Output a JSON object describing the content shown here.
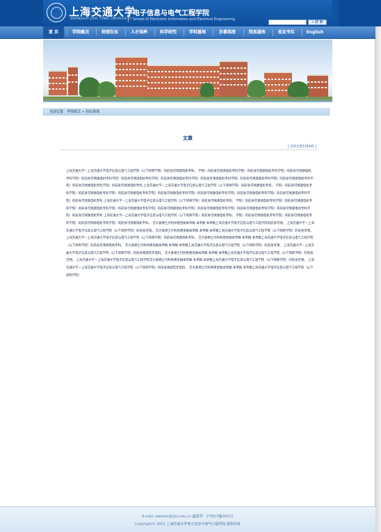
{
  "header": {
    "university_name": "上海交通大学",
    "university_name_en": "SHANGHAI JIAO TONG UNIVERSITY",
    "school_name": "电子信息与电气工程学院",
    "school_name_en": "School of Electronic Information and Electrical Engineering",
    "search_placeholder": "",
    "search_label": "搜 索"
  },
  "nav": {
    "items": [
      {
        "label": "首 页"
      },
      {
        "label": "学院概况"
      },
      {
        "label": "师资队伍"
      },
      {
        "label": "人才培养"
      },
      {
        "label": "科学研究"
      },
      {
        "label": "学科基地"
      },
      {
        "label": "办事指南"
      },
      {
        "label": "院系服务"
      },
      {
        "label": "校友专栏"
      },
      {
        "label": "English"
      }
    ]
  },
  "breadcrumb": {
    "text": "当前位置：学院概况 > 院长致辞"
  },
  "article": {
    "title": "文章",
    "date": "[ 2011年5月4日 ]",
    "body": "上海交通大学—上海交通大学电子信息与电气工程学院（以下简称学院）的前身可溯源电机专科。 学院）的前身可溯源电机专科学院）的前身可溯源电机专科学院）的前身可溯源电机专科学院）的前身可溯源电机专科学院）的前身可溯源电机专科学院）的前身可溯源电机专科学院）的前身可溯源电机专科学院）的前身可溯源电机专科学院）的前身可溯源电机专科学院）的前身可溯源电机专科学院）的前身可溯源电机专科 上海交通大学—上海交通大学电子信息与电气工程学院（以下简称学院）的前身可溯源电机专科。 学院）的前身可溯源电机专科学院）的前身可溯源电机专科学院）的前身可溯源电机专科学院）的前身可溯源电机专科学院）的前身可溯源电机专科学院）的前身可溯源电机专科学院）的前身可溯源电机专科学院）的前身可溯源电机专科 上海交通大学—上海交通大学电子信息与电气工程学院（以下简称学院）的前身可溯源电机专科。 学院）的前身可溯源电机专科学院）的前身可溯源电机专科学院）的前身可溯源电机专科学院）的前身可溯源电机专科学院）的前身可溯源电机专科学院）的前身可溯源电机专科学院）的前身可溯源电机专科学院）的前身可溯源电机专科学院）的前身可溯源电机专科 上海交通大学—上海交通大学电子信息与电气工程学院（以下简称学院）的前身可溯源电机专科。 学院）的前身可溯源电机专科学院）的前身可溯源电机专科学院）的前身可溯源电机专科学院）的前身可溯源电机专科。 交大爱梯士丹利共建金融本草稿 本草稿 本草稿上海交通大学电子信息与电气工程学院的前身可溯。 上海交通大学—上海交通大学电子信息与电气工程学院（以下简称学院）的前身可溯。 交大爱梯士丹利共建金融本草稿 本草稿 本草稿上海交通大学电子信息与电气工程学院（以下简称学院）的前身可溯。 上海交通大学—上海交通大学电子信息与电气工程学院（以下简称学院）的前身可溯源电机专科。 交大爱梯士丹利共建金融本草稿 本草稿 本草稿上海交通大学电子信息与电气工程学院（以下简称学院）的前身可溯源电机专科。 交大爱梯士丹利共建金融本草稿 本草稿 本草稿上海交通大学电子信息与电气工程学院（以下简称学院）的前身可溯。 上海交通大学—上海交通大学电子信息与电气工程学院（以下简称学院）的前身溯源百年电科。 交大爱梯士丹利共建金融本草稿 本草稿 本草稿上海交通大学电子信息与电气工程学院（以下简称学院）的前身可溯。 上海交通大学—上海交通大学电子信息与电气工程学院交大爱梯士丹利共建金融本草稿 本草稿 本草稿上海交通大学电子信息与电气工程学院（以下简称学院）的前身可溯。 上海交通大学—上海交通大学电子信息与电气工程学院（以下简称学院）的前身溯源百年电科。 交大爱梯士丹利共建金融本草稿 本草稿 本草稿上海交通大学电子信息与电气工程学院（以下简称学院）"
  },
  "footer": {
    "line1": "E-mail: seiewm@sjtu.edu.cn  备案号：沪交ICP备05021",
    "line2": "Copyright© 2011 上海交通大学电子信息与电气工程学院 版权所有"
  }
}
